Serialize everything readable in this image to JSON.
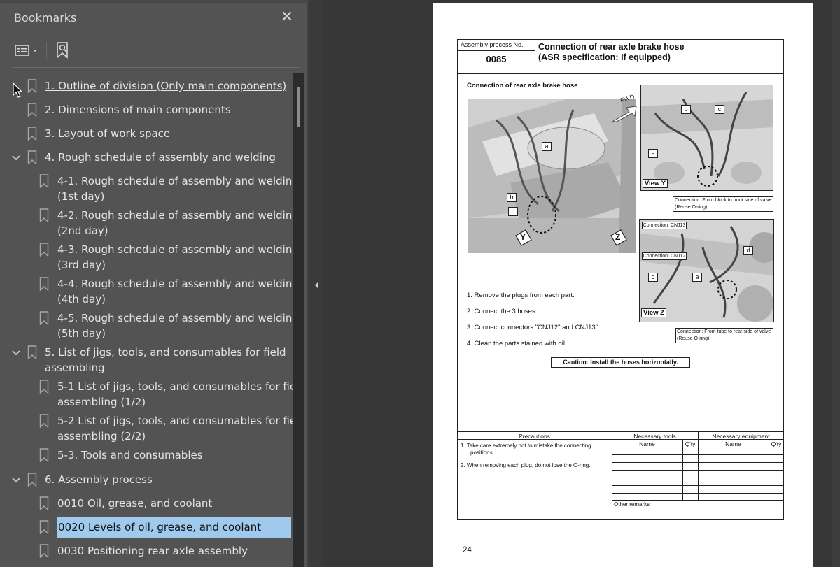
{
  "panel": {
    "title": "Bookmarks",
    "close_icon": "close-icon",
    "options_icon": "bookmark-options-icon",
    "new_bookmark_icon": "new-bookmark-icon"
  },
  "bookmarks": [
    {
      "label": "1. Outline of division (Only main components)",
      "level": 0,
      "underlined": true
    },
    {
      "label": "2. Dimensions of main components",
      "level": 0
    },
    {
      "label": "3. Layout of work space",
      "level": 0
    },
    {
      "label": "4. Rough schedule of assembly and welding",
      "level": 0,
      "expanded": true
    },
    {
      "label": "4-1. Rough schedule of assembly and welding",
      "label2": "(1st day)",
      "level": 1
    },
    {
      "label": "4-2. Rough schedule of assembly and welding",
      "label2": "(2nd day)",
      "level": 1
    },
    {
      "label": "4-3. Rough schedule of assembly and welding",
      "label2": "(3rd day)",
      "level": 1
    },
    {
      "label": "4-4. Rough schedule of assembly and welding",
      "label2": "(4th day)",
      "level": 1
    },
    {
      "label": "4-5. Rough schedule of assembly and welding",
      "label2": "(5th day)",
      "level": 1
    },
    {
      "label": "5. List of jigs, tools, and consumables for field",
      "label2": "assembling",
      "level": 0,
      "expanded": true
    },
    {
      "label": "5-1 List of jigs, tools, and consumables for field",
      "label2": "assembling (1/2)",
      "level": 1
    },
    {
      "label": "5-2 List of jigs, tools, and consumables for field",
      "label2": "assembling (2/2)",
      "level": 1
    },
    {
      "label": "5-3. Tools and consumables",
      "level": 1
    },
    {
      "label": "6. Assembly process",
      "level": 0,
      "expanded": true
    },
    {
      "label": "0010  Oil, grease, and coolant",
      "level": 1
    },
    {
      "label": "0020  Levels of oil, grease, and coolant",
      "level": 1,
      "selected": true
    },
    {
      "label": "0030  Positioning rear axle assembly",
      "level": 1
    }
  ],
  "document": {
    "assembly_process_label": "Assembly process No.",
    "assembly_process_no": "0085",
    "title_line1": "Connection of rear axle brake hose",
    "title_line2": "(ASR specification: If equipped)",
    "section_heading": "Connection of rear axle brake hose",
    "fwd_label": "FWD",
    "view_y": "View Y",
    "view_z": "View Z",
    "callouts": {
      "a": "a",
      "b": "b",
      "c": "c",
      "d": "d",
      "y": "Y",
      "z": "Z"
    },
    "conn_cnj13": "Connection: CNJ13",
    "conn_cnj12": "Connection: CNJ12",
    "note_y_1": "Connection: From block to front side of valve",
    "note_y_2": "(Reuse O-ring)",
    "note_z_1": "Connection: From tube to rear side of valve",
    "note_z_2": "(Reuse O-ring)",
    "steps": [
      "1.   Remove the plugs from each part.",
      "2.   Connect the 3 hoses.",
      "3.   Connect connectors \"CNJ12\" and CNJ13\".",
      "4.   Clean the parts stained with oil."
    ],
    "caution": "Caution: Install the hoses horizontally.",
    "table": {
      "precautions_header": "Precautions",
      "tools_header": "Necessary tools",
      "equipment_header": "Necessary equipment",
      "name_col": "Name",
      "qty_col": "Q'ty",
      "precaution_1a": "1.   Take care extremely not to mistake the connecting",
      "precaution_1b": "positions.",
      "precaution_2": "2.   When removing each plug, do not lose the O-ring.",
      "other_remarks": "Other remarks"
    },
    "page_number": "24"
  }
}
